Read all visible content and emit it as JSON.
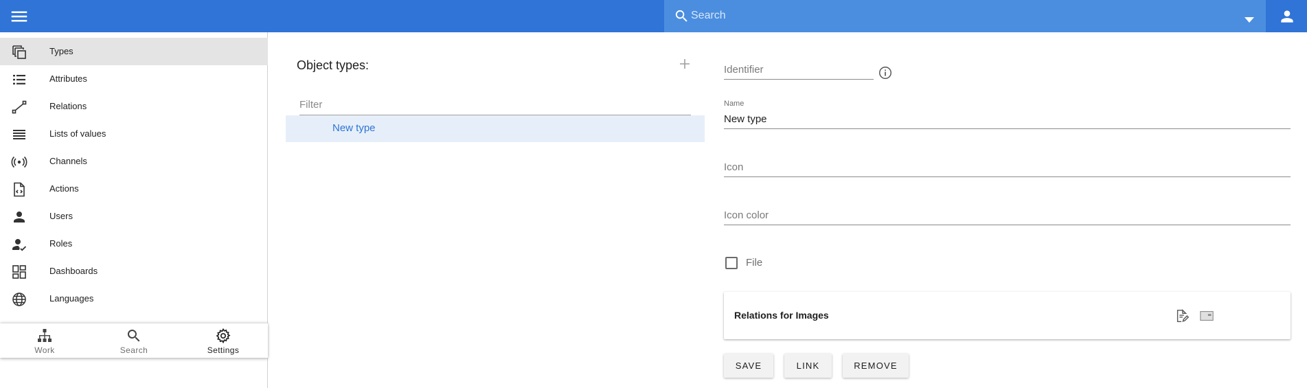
{
  "header": {
    "search_placeholder": "Search",
    "brand_color": "#2f74d6"
  },
  "sidebar": {
    "items": [
      {
        "label": "Types",
        "icon": "types-icon",
        "active": true
      },
      {
        "label": "Attributes",
        "icon": "list-icon"
      },
      {
        "label": "Relations",
        "icon": "relations-icon"
      },
      {
        "label": "Lists of values",
        "icon": "lines-icon"
      },
      {
        "label": "Channels",
        "icon": "channels-icon"
      },
      {
        "label": "Actions",
        "icon": "code-file-icon"
      },
      {
        "label": "Users",
        "icon": "person-icon"
      },
      {
        "label": "Roles",
        "icon": "person-check-icon"
      },
      {
        "label": "Dashboards",
        "icon": "dashboard-icon"
      },
      {
        "label": "Languages",
        "icon": "globe-icon"
      }
    ],
    "bottom_nav": [
      {
        "label": "Work",
        "icon": "sitemap-icon"
      },
      {
        "label": "Search",
        "icon": "search-icon"
      },
      {
        "label": "Settings",
        "icon": "gear-icon",
        "active": true
      }
    ]
  },
  "types_panel": {
    "title": "Object types:",
    "filter_placeholder": "Filter",
    "items": [
      "New type"
    ]
  },
  "form": {
    "identifier_placeholder": "Identifier",
    "name_label": "Name",
    "name_value": "New type",
    "icon_placeholder": "Icon",
    "icon_color_placeholder": "Icon color",
    "file_label": "File",
    "file_checked": false,
    "relations_title": "Relations for Images",
    "buttons": {
      "save": "SAVE",
      "link": "LINK",
      "remove": "REMOVE"
    }
  }
}
